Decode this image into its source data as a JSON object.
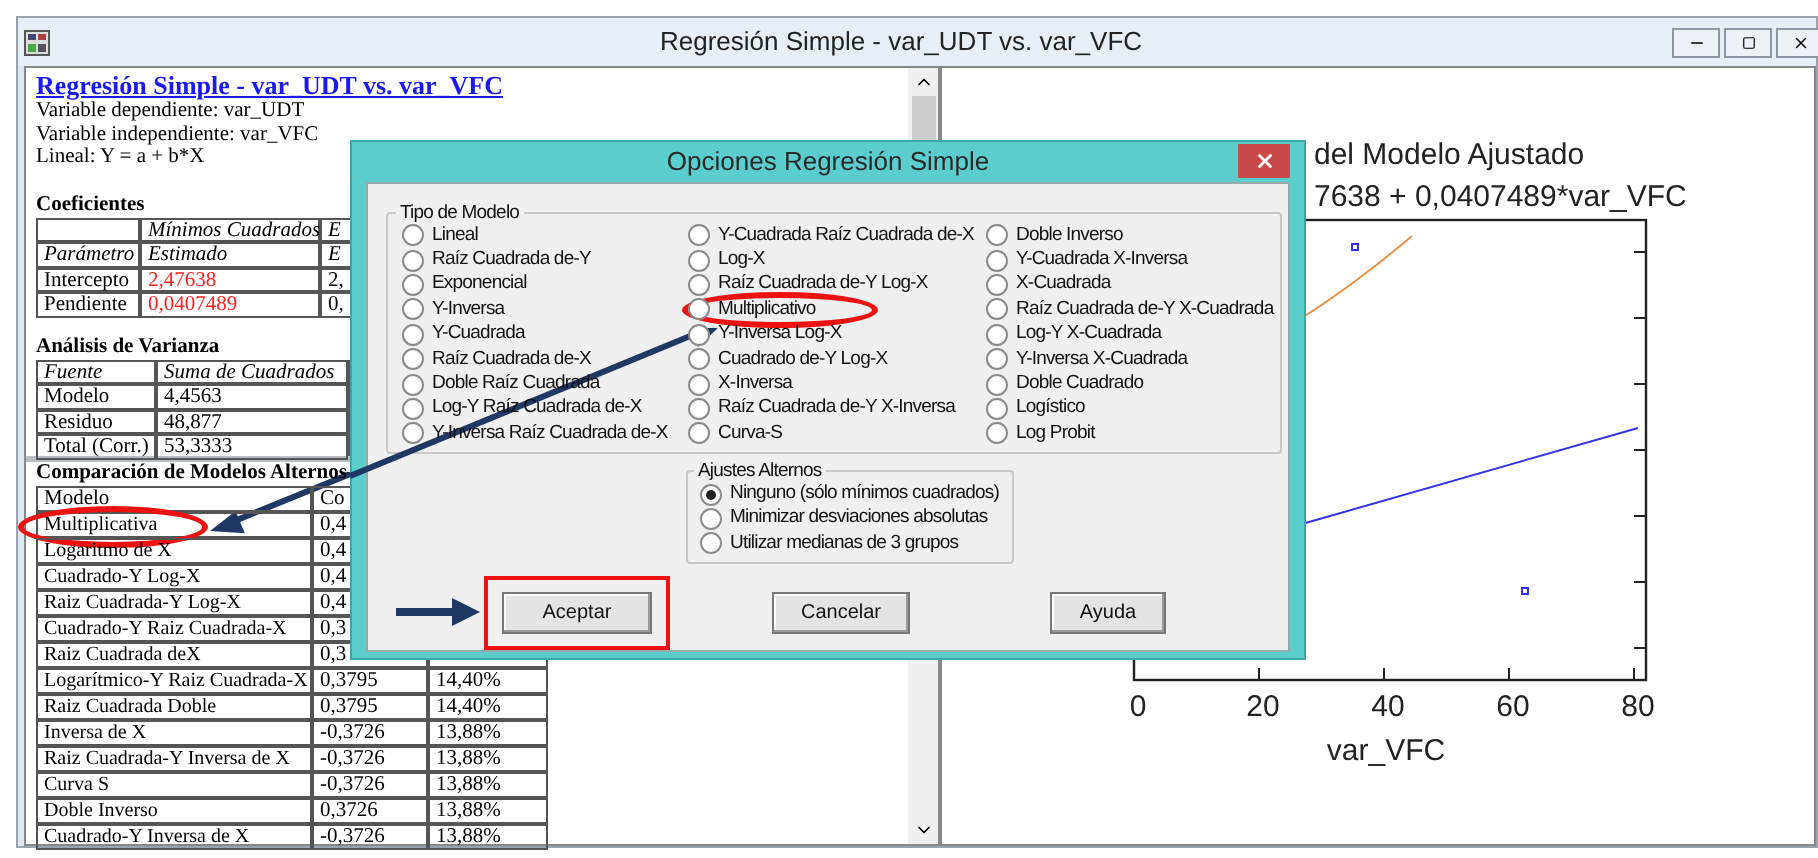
{
  "window": {
    "title": "Regresión Simple - var_UDT vs. var_VFC"
  },
  "report": {
    "heading": "Regresión Simple - var_UDT vs. var_VFC",
    "lines": [
      "Variable dependiente: var_UDT",
      "Variable independiente: var_VFC",
      "Lineal: Y = a + b*X"
    ],
    "coefficients": {
      "title": "Coeficientes",
      "header_1": [
        "Mínimos Cuadrados",
        "E"
      ],
      "header_2": [
        "Parámetro",
        "Estimado",
        "E"
      ],
      "rows": [
        {
          "parameter": "Intercepto",
          "estimate": "2,47638",
          "highlighted": true,
          "column_3": "2,"
        },
        {
          "parameter": "Pendiente",
          "estimate": "0,0407489",
          "highlighted": true,
          "column_3": "0,"
        }
      ]
    },
    "anova": {
      "title": "Análisis de Varianza",
      "header": [
        "Fuente",
        "Suma de Cuadrados"
      ],
      "rows": [
        [
          "Modelo",
          "4,4563"
        ],
        [
          "Residuo",
          "48,877"
        ],
        [
          "Total (Corr.)",
          "53,3333"
        ]
      ]
    }
  },
  "comparison": {
    "title": "Comparación de Modelos Alternos",
    "header": [
      "Modelo",
      "Co"
    ],
    "rows": [
      {
        "model": "Multiplicativa",
        "correlation": "0,4",
        "circled": true
      },
      {
        "model": "Logaritmo de X",
        "correlation": "0,4",
        "circled": false
      },
      {
        "model": "Cuadrado-Y Log-X",
        "correlation": "0,4",
        "circled": false
      },
      {
        "model": "Raiz Cuadrada-Y Log-X",
        "correlation": "0,4",
        "circled": false
      },
      {
        "model": "Cuadrado-Y Raiz Cuadrada-X",
        "correlation": "0,3",
        "circled": false
      },
      {
        "model": "Raiz Cuadrada deX",
        "correlation": "0,3",
        "circled": false
      },
      {
        "model": "Logarítmico-Y Raiz Cuadrada-X",
        "correlation": "0,3795",
        "r_squared": "14,40%",
        "circled": false
      },
      {
        "model": "Raiz Cuadrada Doble",
        "correlation": "0,3795",
        "r_squared": "14,40%",
        "circled": false
      },
      {
        "model": "Inversa de X",
        "correlation": "-0,3726",
        "r_squared": "13,88%",
        "circled": false
      },
      {
        "model": "Raiz Cuadrada-Y Inversa de X",
        "correlation": "-0,3726",
        "r_squared": "13,88%",
        "circled": false
      },
      {
        "model": "Curva S",
        "correlation": "-0,3726",
        "r_squared": "13,88%",
        "circled": false
      },
      {
        "model": "Doble Inverso",
        "correlation": "0,3726",
        "r_squared": "13,88%",
        "circled": false
      },
      {
        "model": "Cuadrado-Y Inversa de X",
        "correlation": "-0,3726",
        "r_squared": "13,88%",
        "circled": false
      }
    ]
  },
  "chart": {
    "title": "del Modelo Ajustado",
    "subtitle": "7638 + 0,0407489*var_VFC",
    "xticks": [
      "0",
      "20",
      "40",
      "60",
      "80"
    ],
    "xlabel": "var_VFC"
  },
  "dialog": {
    "title": "Opciones Regresión Simple",
    "model_group": {
      "label": "Tipo de Modelo",
      "columns": [
        [
          {
            "label": "Lineal",
            "selected": false,
            "circled": false
          },
          {
            "label": "Raíz Cuadrada de-Y",
            "selected": false,
            "circled": false
          },
          {
            "label": "Exponencial",
            "selected": false,
            "circled": false
          },
          {
            "label": "Y-Inversa",
            "selected": false,
            "circled": false
          },
          {
            "label": "Y-Cuadrada",
            "selected": false,
            "circled": false
          },
          {
            "label": "Raíz Cuadrada de-X",
            "selected": false,
            "circled": false
          },
          {
            "label": "Doble Raíz Cuadrada",
            "selected": false,
            "circled": false
          },
          {
            "label": "Log-Y Raíz Cuadrada de-X",
            "selected": false,
            "circled": false
          },
          {
            "label": "Y-Inversa Raíz Cuadrada de-X",
            "selected": false,
            "circled": false
          }
        ],
        [
          {
            "label": "Y-Cuadrada Raíz Cuadrada de-X",
            "selected": false,
            "circled": false
          },
          {
            "label": "Log-X",
            "selected": false,
            "circled": false
          },
          {
            "label": "Raíz Cuadrada de-Y Log-X",
            "selected": false,
            "circled": false
          },
          {
            "label": "Multiplicativo",
            "selected": false,
            "circled": true
          },
          {
            "label": "Y-Inversa Log-X",
            "selected": false,
            "circled": false
          },
          {
            "label": "Cuadrado de-Y Log-X",
            "selected": false,
            "circled": false
          },
          {
            "label": "X-Inversa",
            "selected": false,
            "circled": false
          },
          {
            "label": "Raíz Cuadrada de-Y X-Inversa",
            "selected": false,
            "circled": false
          },
          {
            "label": "Curva-S",
            "selected": false,
            "circled": false
          }
        ],
        [
          {
            "label": "Doble Inverso",
            "selected": false,
            "circled": false
          },
          {
            "label": "Y-Cuadrada X-Inversa",
            "selected": false,
            "circled": false
          },
          {
            "label": "X-Cuadrada",
            "selected": false,
            "circled": false
          },
          {
            "label": "Raíz Cuadrada de-Y X-Cuadrada",
            "selected": false,
            "circled": false
          },
          {
            "label": "Log-Y X-Cuadrada",
            "selected": false,
            "circled": false
          },
          {
            "label": "Y-Inversa X-Cuadrada",
            "selected": false,
            "circled": false
          },
          {
            "label": "Doble Cuadrado",
            "selected": false,
            "circled": false
          },
          {
            "label": "Logístico",
            "selected": false,
            "circled": false
          },
          {
            "label": "Log Probit",
            "selected": false,
            "circled": false
          }
        ]
      ]
    },
    "fit_group": {
      "label": "Ajustes Alternos",
      "options": [
        {
          "label": "Ninguno (sólo mínimos cuadrados)",
          "selected": true
        },
        {
          "label": "Minimizar desviaciones absolutas",
          "selected": false
        },
        {
          "label": "Utilizar medianas de 3 grupos",
          "selected": false
        }
      ]
    },
    "buttons": [
      {
        "label": "Aceptar",
        "highlighted": true
      },
      {
        "label": "Cancelar",
        "highlighted": false
      },
      {
        "label": "Ayuda",
        "highlighted": false
      }
    ]
  }
}
